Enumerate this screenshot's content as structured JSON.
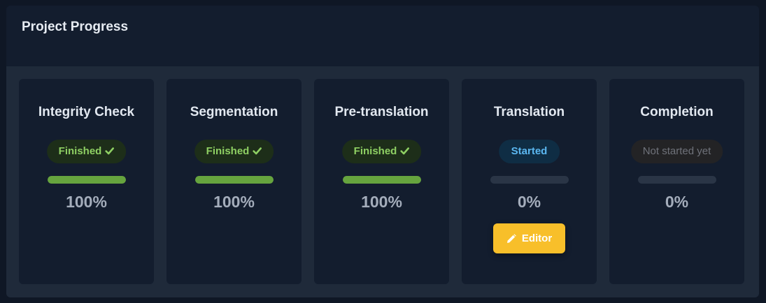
{
  "panel": {
    "title": "Project Progress"
  },
  "colors": {
    "finished": "#8ecf63",
    "progress_fill": "#66a43e",
    "started": "#5bb7f0",
    "editor_button": "#f8bf2a"
  },
  "steps": [
    {
      "title": "Integrity Check",
      "status": "Finished",
      "status_type": "finished",
      "progress": 100,
      "percent_label": "100%"
    },
    {
      "title": "Segmentation",
      "status": "Finished",
      "status_type": "finished",
      "progress": 100,
      "percent_label": "100%"
    },
    {
      "title": "Pre-translation",
      "status": "Finished",
      "status_type": "finished",
      "progress": 100,
      "percent_label": "100%"
    },
    {
      "title": "Translation",
      "status": "Started",
      "status_type": "started",
      "progress": 0,
      "percent_label": "0%",
      "action": {
        "label": "Editor",
        "icon": "pencil-icon"
      }
    },
    {
      "title": "Completion",
      "status": "Not started yet",
      "status_type": "not-started",
      "progress": 0,
      "percent_label": "0%"
    }
  ]
}
